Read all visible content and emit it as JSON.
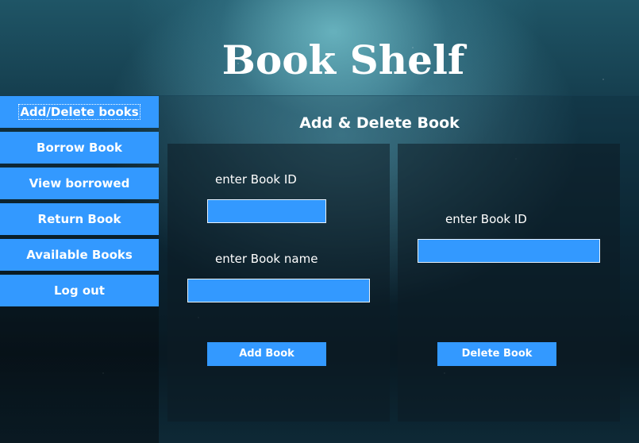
{
  "app": {
    "title": "Book Shelf"
  },
  "sidebar": {
    "items": [
      {
        "label": "Add/Delete books",
        "active": true
      },
      {
        "label": "Borrow Book",
        "active": false
      },
      {
        "label": "View borrowed",
        "active": false
      },
      {
        "label": "Return Book",
        "active": false
      },
      {
        "label": "Available Books",
        "active": false
      },
      {
        "label": "Log out",
        "active": false
      }
    ]
  },
  "main": {
    "section_title": "Add & Delete Book",
    "add_form": {
      "book_id_label": "enter Book ID",
      "book_id_value": "",
      "book_name_label": "enter Book name",
      "book_name_value": "",
      "submit_label": "Add Book"
    },
    "delete_form": {
      "book_id_label": "enter Book ID",
      "book_id_value": "",
      "submit_label": "Delete Book"
    }
  },
  "colors": {
    "accent": "#3399ff",
    "text": "#ffffff"
  }
}
